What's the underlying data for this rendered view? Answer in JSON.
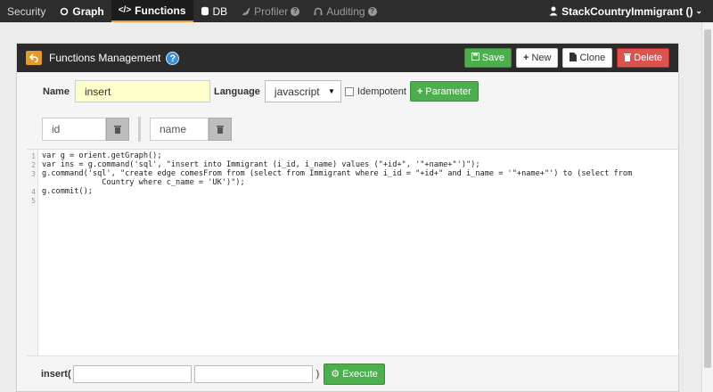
{
  "nav": {
    "items": [
      {
        "label": "Security",
        "icon": ""
      },
      {
        "label": "Graph",
        "icon": "circle-icon"
      },
      {
        "label": "Functions",
        "icon": "code-icon",
        "active": true
      },
      {
        "label": "DB",
        "icon": "database-icon"
      },
      {
        "label": "Profiler",
        "icon": "rocket-icon",
        "help": "?"
      },
      {
        "label": "Auditing",
        "icon": "headset-icon",
        "help": "?"
      }
    ],
    "user": "StackCountryImmigrant ()"
  },
  "panel": {
    "title": "Functions Management",
    "help": "?",
    "buttons": {
      "save": "Save",
      "new": "New",
      "clone": "Clone",
      "delete": "Delete"
    }
  },
  "form": {
    "name_label": "Name",
    "name_value": "insert",
    "language_label": "Language",
    "language_value": "javascript",
    "idempotent_label": "Idempotent",
    "parameter_button": "Parameter"
  },
  "params": [
    "id",
    "name"
  ],
  "code": {
    "line_numbers": [
      "1",
      "2",
      "3",
      "4",
      "5"
    ],
    "lines": [
      "var g = orient.getGraph();",
      "var ins = g.command('sql', \"insert into Immigrant (i_id, i_name) values (\"+id+\", '\"+name+\"')\");",
      "g.command('sql', \"create edge comesFrom from (select from Immigrant where i_id = \"+id+\" and i_name = '\"+name+\"') to (select from",
      "             Country where c_name = 'UK')\");",
      "g.commit();"
    ]
  },
  "execute": {
    "fn_label": "insert(",
    "close_paren": ")",
    "button": "Execute"
  },
  "colors": {
    "accent": "#e59b27",
    "green": "#4cae4c",
    "red": "#d9534f",
    "name_bg": "#ffffcc"
  }
}
